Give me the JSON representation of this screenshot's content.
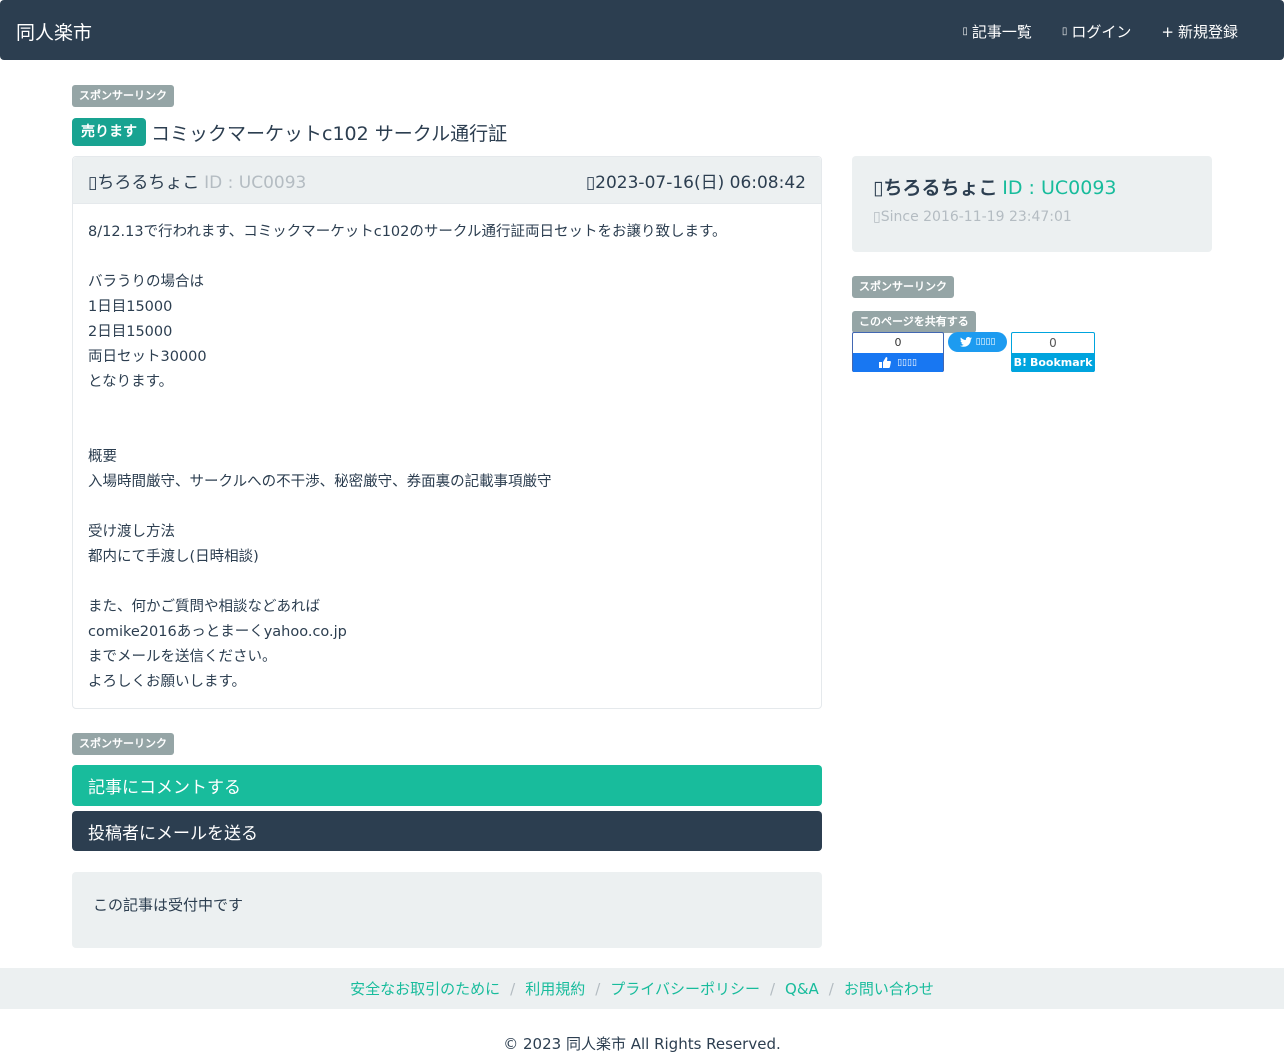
{
  "navbar": {
    "brand": "同人楽市",
    "links": [
      {
        "glyph": "▯",
        "label": "記事一覧"
      },
      {
        "glyph": "▯",
        "label": "ログイン"
      },
      {
        "glyph": "+",
        "label": "新規登録"
      }
    ]
  },
  "sponsor_label": "スポンサーリンク",
  "post": {
    "type_badge": "売ります",
    "title": "コミックマーケットc102 サークル通行証",
    "author_glyph": "▯",
    "author_name": "ちろるちょこ",
    "author_id": "ID : UC0093",
    "date_glyph": "▯",
    "date": "2023-07-16(日) 06:08:42",
    "body_lines": [
      "8/12.13で行われます、コミックマーケットc102のサークル通行証両日セットをお譲り致します。",
      "",
      "バラうりの場合は",
      "1日目15000",
      "2日目15000",
      "両日セット30000",
      "となります。",
      "",
      "",
      "概要",
      "入場時間厳守、サークルへの不干渉、秘密厳守、券面裏の記載事項厳守",
      "",
      "受け渡し方法",
      "都内にて手渡し(日時相談)",
      "",
      "また、何かご質問や相談などあれば",
      "comike2016あっとまーくyahoo.co.jp",
      "までメールを送信ください。",
      "よろしくお願いします。"
    ]
  },
  "actions": {
    "comment_label": "記事にコメントする",
    "mail_label": "投稿者にメールを送る"
  },
  "status_text": "この記事は受付中です",
  "profile": {
    "glyph": "▯",
    "name": "ちろるちょこ",
    "id": "ID : UC0093",
    "since_glyph": "▯",
    "since": "Since 2016-11-19 23:47:01"
  },
  "share": {
    "label": "このページを共有する",
    "fb_count": "0",
    "fb_like": "▯▯▯▯",
    "tw_label": "▯▯▯▯",
    "hb_count": "0",
    "hb_label": "Bookmark"
  },
  "footer": {
    "links": [
      "安全なお取引のために",
      "利用規約",
      "プライバシーポリシー",
      "Q&A",
      "お問い合わせ"
    ],
    "separator": "/",
    "copyright": "© 2023 同人楽市 All Rights Reserved."
  },
  "colors": {
    "navbar": "#2c3e50",
    "accent": "#18bc9c",
    "sell_badge": "#18a391",
    "badge_gray": "#95a5a6",
    "panel": "#ecf0f1"
  }
}
